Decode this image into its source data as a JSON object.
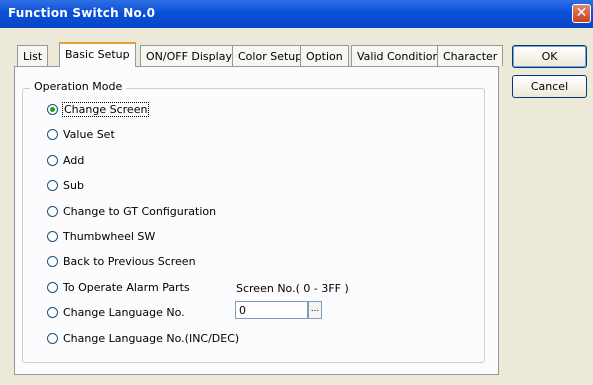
{
  "window": {
    "title": "Function Switch No.0",
    "close_glyph": "✕",
    "accent_color": "#0a4fd8"
  },
  "tabs": [
    {
      "label": "List",
      "active": false
    },
    {
      "label": "Basic Setup",
      "active": true
    },
    {
      "label": "ON/OFF Display",
      "active": false
    },
    {
      "label": "Color Setup",
      "active": false
    },
    {
      "label": "Option",
      "active": false
    },
    {
      "label": "Valid Condition",
      "active": false
    },
    {
      "label": "Character",
      "active": false
    }
  ],
  "operation_mode": {
    "title": "Operation Mode",
    "options": [
      {
        "label": "Change Screen",
        "checked": true
      },
      {
        "label": "Value Set",
        "checked": false
      },
      {
        "label": "Add",
        "checked": false
      },
      {
        "label": "Sub",
        "checked": false
      },
      {
        "label": "Change to GT Configuration",
        "checked": false
      },
      {
        "label": "Thumbwheel SW",
        "checked": false
      },
      {
        "label": "Back to Previous Screen",
        "checked": false
      },
      {
        "label": "To Operate Alarm Parts",
        "checked": false
      },
      {
        "label": "Change Language No.",
        "checked": false
      },
      {
        "label": "Change Language No.(INC/DEC)",
        "checked": false
      }
    ],
    "screen_no_label": "Screen No.( 0 - 3FF )",
    "language_no_value": "0",
    "browse_label": "..."
  },
  "buttons": {
    "ok": "OK",
    "cancel": "Cancel"
  }
}
